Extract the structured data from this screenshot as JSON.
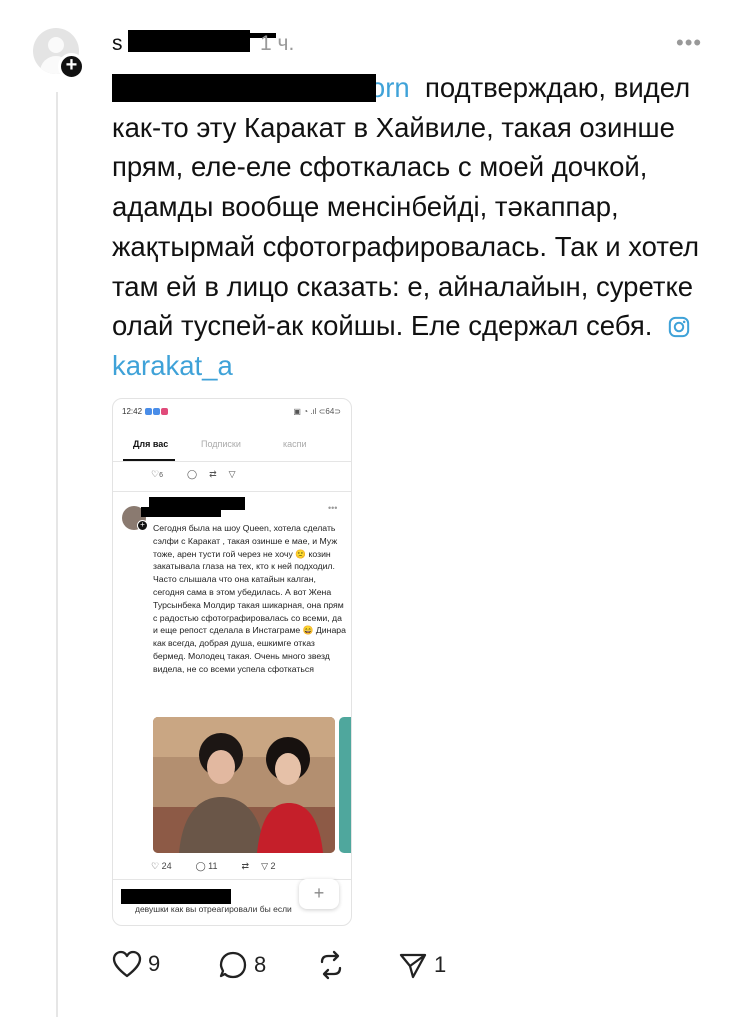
{
  "post": {
    "username": "s",
    "time": "1 ч.",
    "more": "•••",
    "mention": "@",
    "mention_suffix": "orn",
    "body": "подтверждаю, видел как-то эту Каракат в Хайвиле, такая озинше прям, еле-еле сфоткалась с моей дочкой, адамды вообще менсінбейді, тәкаппар, жақтырмай сфотографировалась. Так и хотел там ей в лицо сказать: е, айналайын, суретке олай туспей-ак койшы. Еле сдержал себя.",
    "tag": "karakat_a",
    "tag_icon": "instagram-icon",
    "likes": "9",
    "replies": "8",
    "reposts": "",
    "shares": "1"
  },
  "screenshot": {
    "status_time": "12:42",
    "status_right": "▣ ◔ .ıl ⊂64⊃",
    "tabs": [
      "Для вас",
      "Подписки",
      "каспи"
    ],
    "top_likes": "6",
    "more": "•••",
    "text": "Сегодня была на шоу Queen, хотела сделать сэлфи с Каракат , такая озинше е мае, и Муж тоже, арен тусти гой через не хочу 🙁 козин закатывала глаза на тех, кто к ней подходил. Часто слышала что она катайын калган, сегодня сама в этом убедилась. А вот Жена Турсынбека Молдир такая шикарная, она прям с радостью сфотографировалась со всеми, да и еще репост сделала в Инстаграме 😄 Динара как всегда, добрая душа, ешкимге отказ бермед. Молодец такая. Очень много звезд видела, не со всеми успела сфоткаться",
    "likes": "24",
    "replies": "11",
    "shares": "2",
    "next_text": "девушки как вы отреагировали бы если",
    "fab": "+"
  }
}
